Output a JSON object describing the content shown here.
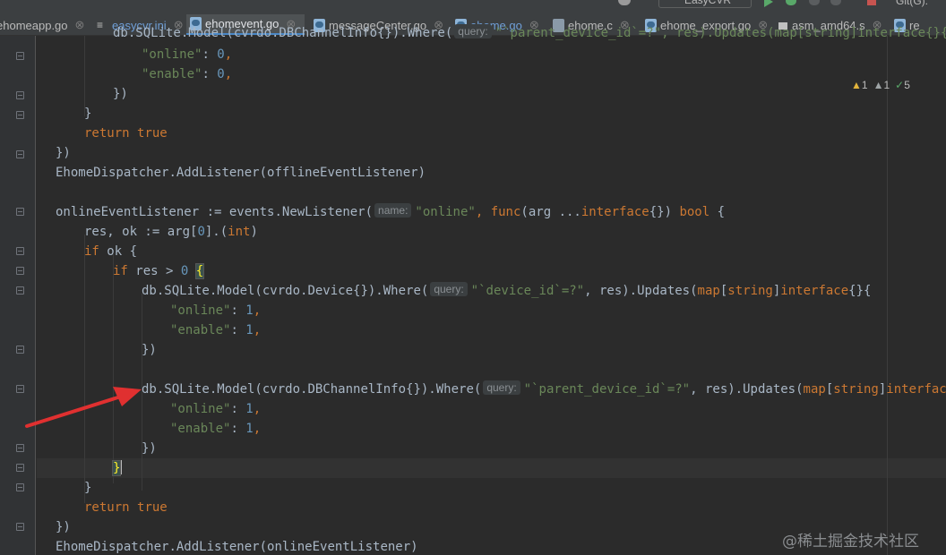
{
  "tabs": [
    {
      "label": "ehomeapp.go",
      "icon": "go-file-icon",
      "active": false
    },
    {
      "label": "easycvr.ini",
      "icon": "ini-file-icon",
      "active": false
    },
    {
      "label": "ehomevent.go",
      "icon": "go-file-icon",
      "active": true
    },
    {
      "label": "messageCenter.go",
      "icon": "go-file-icon",
      "active": false
    },
    {
      "label": "ehome.go",
      "icon": "go-file-icon",
      "active": false
    },
    {
      "label": "ehome.c",
      "icon": "c-file-icon",
      "active": false
    },
    {
      "label": "ehome_export.go",
      "icon": "go-file-icon",
      "active": false
    },
    {
      "label": "asm_amd64.s",
      "icon": "asm-file-icon",
      "active": false
    },
    {
      "label": "re",
      "icon": "go-file-icon",
      "active": false
    }
  ],
  "toolbar": {
    "run_config": "EasyCVR",
    "git_label": "Git(G):"
  },
  "inspections": {
    "warnings": "1",
    "weak_warnings": "1",
    "typos": "5"
  },
  "code": {
    "l0_a": "db.SQLite.Model(cvrdo.DBChannelInfo{}).Where(",
    "l0_hint": "query:",
    "l0_b": "\"`parent_device_id`=?\", res).Updates(map[string]interface{}{",
    "l1_key": "\"online\"",
    "l1_colon": ": ",
    "l1_val": "0",
    "l1_comma": ",",
    "l2_key": "\"enable\"",
    "l2_val": "0",
    "l3": "})",
    "l4": "}",
    "l5_kw": "return",
    "l5_val": "true",
    "l6": "})",
    "l7_obj": "EhomeDispatcher",
    "l7_dot": ".",
    "l7_fn": "AddListener",
    "l7_arg": "(offlineEventListener)",
    "l9_var": "onlineEventListener := ",
    "l9_pkg": "events",
    "l9_fn": "NewListener",
    "l9_open": "(",
    "l9_hint": "name:",
    "l9_str": "\"online\"",
    "l9_comma": ", ",
    "l9_func": "func",
    "l9_args": "(arg ...",
    "l9_iface": "interface",
    "l9_braces": "{}) ",
    "l9_bool": "bool",
    "l9_open2": " {",
    "l10_a": "res, ok := arg[",
    "l10_idx": "0",
    "l10_b": "].(",
    "l10_int": "int",
    "l10_c": ")",
    "l11_kw": "if",
    "l11_rest": " ok {",
    "l12_kw": "if",
    "l12_a": " res > ",
    "l12_num": "0",
    "l12_brace": "{",
    "l13_a": "db.SQLite.Model(cvrdo.",
    "l13_type": "Device",
    "l13_b": "{}).Where(",
    "l13_hint": "query:",
    "l13_str": "\"`device_id`=?\"",
    "l13_c": ", res).Updates(",
    "l13_map": "map",
    "l13_d": "[",
    "l13_string": "string",
    "l13_e": "]",
    "l13_iface": "interface",
    "l13_f": "{}{",
    "l14_key": "\"online\"",
    "l14_val": "1",
    "l15_key": "\"enable\"",
    "l15_val": "1",
    "l16": "})",
    "l18_a": "db.SQLite.Model(cvrdo.",
    "l18_type": "DBChannelInfo",
    "l18_b": "{}).Where(",
    "l18_hint": "query:",
    "l18_str": "\"`parent_device_id`=?\"",
    "l18_c": ", res).Updates(",
    "l18_map": "map",
    "l18_d": "[",
    "l18_string": "string",
    "l18_e": "]",
    "l18_iface": "interface",
    "l18_f": "{}{",
    "l19_key": "\"online\"",
    "l19_val": "1",
    "l20_key": "\"enable\"",
    "l20_val": "1",
    "l21": "})",
    "l22": "}",
    "l23": "}",
    "l24_kw": "return",
    "l24_val": "true",
    "l25": "})",
    "l26_obj": "EhomeDispatcher",
    "l26_fn": "AddListener",
    "l26_arg": "(onlineEventListener)"
  },
  "watermark": "@稀土掘金技术社区",
  "colors": {
    "background": "#2b2b2b",
    "keyword": "#cc7832",
    "string": "#6a8759",
    "number": "#6897bb",
    "function": "#ffc66d",
    "annotation_arrow": "#e03030"
  }
}
